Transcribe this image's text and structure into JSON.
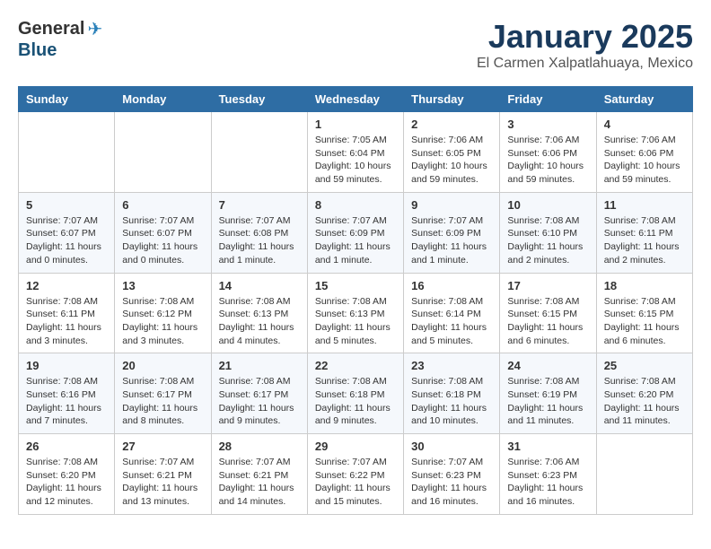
{
  "header": {
    "logo_general": "General",
    "logo_blue": "Blue",
    "month": "January 2025",
    "location": "El Carmen Xalpatlahuaya, Mexico"
  },
  "days_of_week": [
    "Sunday",
    "Monday",
    "Tuesday",
    "Wednesday",
    "Thursday",
    "Friday",
    "Saturday"
  ],
  "weeks": [
    [
      {
        "day": "",
        "info": ""
      },
      {
        "day": "",
        "info": ""
      },
      {
        "day": "",
        "info": ""
      },
      {
        "day": "1",
        "info": "Sunrise: 7:05 AM\nSunset: 6:04 PM\nDaylight: 10 hours\nand 59 minutes."
      },
      {
        "day": "2",
        "info": "Sunrise: 7:06 AM\nSunset: 6:05 PM\nDaylight: 10 hours\nand 59 minutes."
      },
      {
        "day": "3",
        "info": "Sunrise: 7:06 AM\nSunset: 6:06 PM\nDaylight: 10 hours\nand 59 minutes."
      },
      {
        "day": "4",
        "info": "Sunrise: 7:06 AM\nSunset: 6:06 PM\nDaylight: 10 hours\nand 59 minutes."
      }
    ],
    [
      {
        "day": "5",
        "info": "Sunrise: 7:07 AM\nSunset: 6:07 PM\nDaylight: 11 hours\nand 0 minutes."
      },
      {
        "day": "6",
        "info": "Sunrise: 7:07 AM\nSunset: 6:07 PM\nDaylight: 11 hours\nand 0 minutes."
      },
      {
        "day": "7",
        "info": "Sunrise: 7:07 AM\nSunset: 6:08 PM\nDaylight: 11 hours\nand 1 minute."
      },
      {
        "day": "8",
        "info": "Sunrise: 7:07 AM\nSunset: 6:09 PM\nDaylight: 11 hours\nand 1 minute."
      },
      {
        "day": "9",
        "info": "Sunrise: 7:07 AM\nSunset: 6:09 PM\nDaylight: 11 hours\nand 1 minute."
      },
      {
        "day": "10",
        "info": "Sunrise: 7:08 AM\nSunset: 6:10 PM\nDaylight: 11 hours\nand 2 minutes."
      },
      {
        "day": "11",
        "info": "Sunrise: 7:08 AM\nSunset: 6:11 PM\nDaylight: 11 hours\nand 2 minutes."
      }
    ],
    [
      {
        "day": "12",
        "info": "Sunrise: 7:08 AM\nSunset: 6:11 PM\nDaylight: 11 hours\nand 3 minutes."
      },
      {
        "day": "13",
        "info": "Sunrise: 7:08 AM\nSunset: 6:12 PM\nDaylight: 11 hours\nand 3 minutes."
      },
      {
        "day": "14",
        "info": "Sunrise: 7:08 AM\nSunset: 6:13 PM\nDaylight: 11 hours\nand 4 minutes."
      },
      {
        "day": "15",
        "info": "Sunrise: 7:08 AM\nSunset: 6:13 PM\nDaylight: 11 hours\nand 5 minutes."
      },
      {
        "day": "16",
        "info": "Sunrise: 7:08 AM\nSunset: 6:14 PM\nDaylight: 11 hours\nand 5 minutes."
      },
      {
        "day": "17",
        "info": "Sunrise: 7:08 AM\nSunset: 6:15 PM\nDaylight: 11 hours\nand 6 minutes."
      },
      {
        "day": "18",
        "info": "Sunrise: 7:08 AM\nSunset: 6:15 PM\nDaylight: 11 hours\nand 6 minutes."
      }
    ],
    [
      {
        "day": "19",
        "info": "Sunrise: 7:08 AM\nSunset: 6:16 PM\nDaylight: 11 hours\nand 7 minutes."
      },
      {
        "day": "20",
        "info": "Sunrise: 7:08 AM\nSunset: 6:17 PM\nDaylight: 11 hours\nand 8 minutes."
      },
      {
        "day": "21",
        "info": "Sunrise: 7:08 AM\nSunset: 6:17 PM\nDaylight: 11 hours\nand 9 minutes."
      },
      {
        "day": "22",
        "info": "Sunrise: 7:08 AM\nSunset: 6:18 PM\nDaylight: 11 hours\nand 9 minutes."
      },
      {
        "day": "23",
        "info": "Sunrise: 7:08 AM\nSunset: 6:18 PM\nDaylight: 11 hours\nand 10 minutes."
      },
      {
        "day": "24",
        "info": "Sunrise: 7:08 AM\nSunset: 6:19 PM\nDaylight: 11 hours\nand 11 minutes."
      },
      {
        "day": "25",
        "info": "Sunrise: 7:08 AM\nSunset: 6:20 PM\nDaylight: 11 hours\nand 11 minutes."
      }
    ],
    [
      {
        "day": "26",
        "info": "Sunrise: 7:08 AM\nSunset: 6:20 PM\nDaylight: 11 hours\nand 12 minutes."
      },
      {
        "day": "27",
        "info": "Sunrise: 7:07 AM\nSunset: 6:21 PM\nDaylight: 11 hours\nand 13 minutes."
      },
      {
        "day": "28",
        "info": "Sunrise: 7:07 AM\nSunset: 6:21 PM\nDaylight: 11 hours\nand 14 minutes."
      },
      {
        "day": "29",
        "info": "Sunrise: 7:07 AM\nSunset: 6:22 PM\nDaylight: 11 hours\nand 15 minutes."
      },
      {
        "day": "30",
        "info": "Sunrise: 7:07 AM\nSunset: 6:23 PM\nDaylight: 11 hours\nand 16 minutes."
      },
      {
        "day": "31",
        "info": "Sunrise: 7:06 AM\nSunset: 6:23 PM\nDaylight: 11 hours\nand 16 minutes."
      },
      {
        "day": "",
        "info": ""
      }
    ]
  ]
}
